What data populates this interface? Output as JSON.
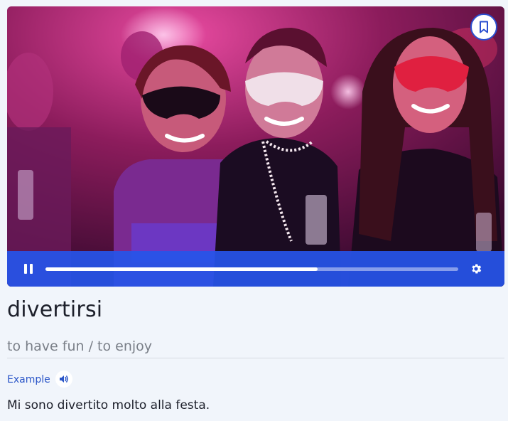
{
  "video": {
    "scene_description": "",
    "bookmark_icon": "bookmark-icon",
    "controls": {
      "pause_icon": "pause-icon",
      "settings_icon": "gear-icon",
      "progress_fraction": 0.66,
      "bar_color": "#2654e8"
    }
  },
  "vocab": {
    "word": "divertirsi",
    "translation": "to have fun / to enjoy"
  },
  "example": {
    "label": "Example",
    "audio_icon": "speaker-icon",
    "sentence": "Mi sono divertito molto alla festa."
  },
  "colors": {
    "accent": "#2b56c8",
    "background": "#f1f5fb"
  }
}
